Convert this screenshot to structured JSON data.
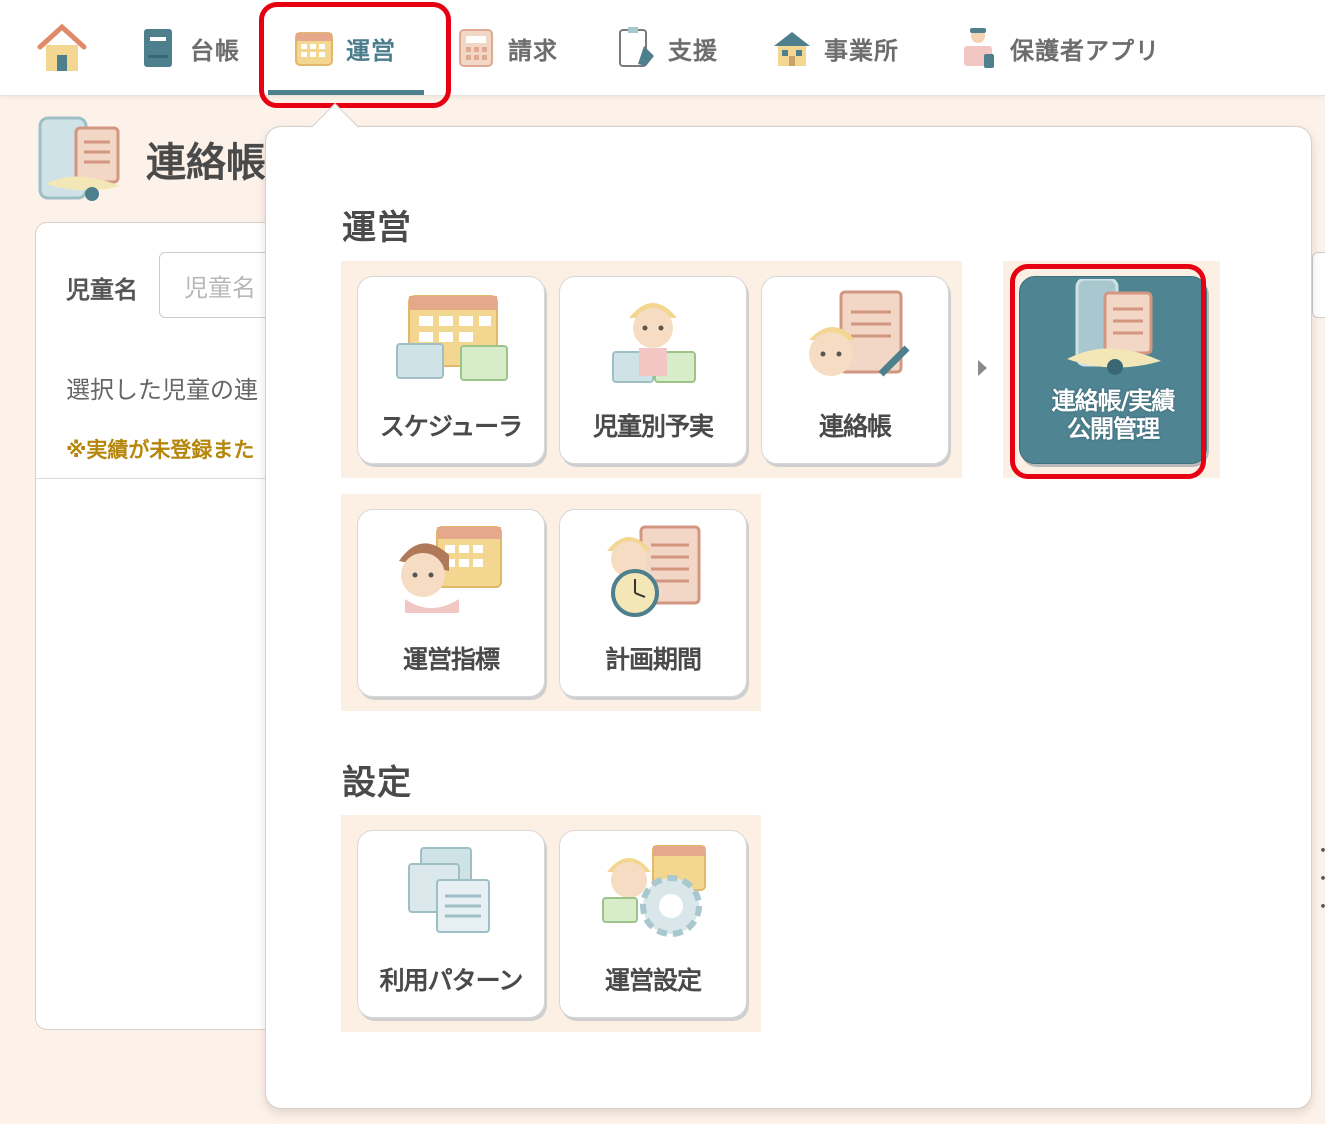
{
  "nav": {
    "items": [
      {
        "label": "",
        "icon": "home-icon"
      },
      {
        "label": "台帳",
        "icon": "ledger-icon"
      },
      {
        "label": "運営",
        "icon": "calendar-icon"
      },
      {
        "label": "請求",
        "icon": "calculator-icon"
      },
      {
        "label": "支援",
        "icon": "clipboard-icon"
      },
      {
        "label": "事業所",
        "icon": "office-icon"
      },
      {
        "label": "保護者アプリ",
        "icon": "guardian-app-icon"
      }
    ],
    "active_label": "運営"
  },
  "page": {
    "title": "連絡帳/実績公開管理",
    "child_label": "児童名",
    "child_placeholder": "児童名",
    "selected_text": "選択した児童の連",
    "note_text": "※実績が未登録また"
  },
  "menu": {
    "section_operation": "運営",
    "section_settings": "設定",
    "tiles_row1": [
      {
        "label": "スケジューラ",
        "icon": "scheduler-icon"
      },
      {
        "label": "児童別予実",
        "icon": "child-plan-icon"
      },
      {
        "label": "連絡帳",
        "icon": "contact-book-icon"
      }
    ],
    "highlighted_tile": {
      "line1": "連絡帳/実績",
      "line2": "公開管理",
      "icon": "publish-management-icon"
    },
    "tiles_row2": [
      {
        "label": "運営指標",
        "icon": "operation-index-icon"
      },
      {
        "label": "計画期間",
        "icon": "plan-period-icon"
      }
    ],
    "tiles_settings": [
      {
        "label": "利用パターン",
        "icon": "usage-pattern-icon"
      },
      {
        "label": "運営設定",
        "icon": "operation-settings-icon"
      }
    ]
  },
  "colors": {
    "accent": "#4f8593",
    "highlight": "#e60012",
    "background": "#fdf2e9"
  }
}
